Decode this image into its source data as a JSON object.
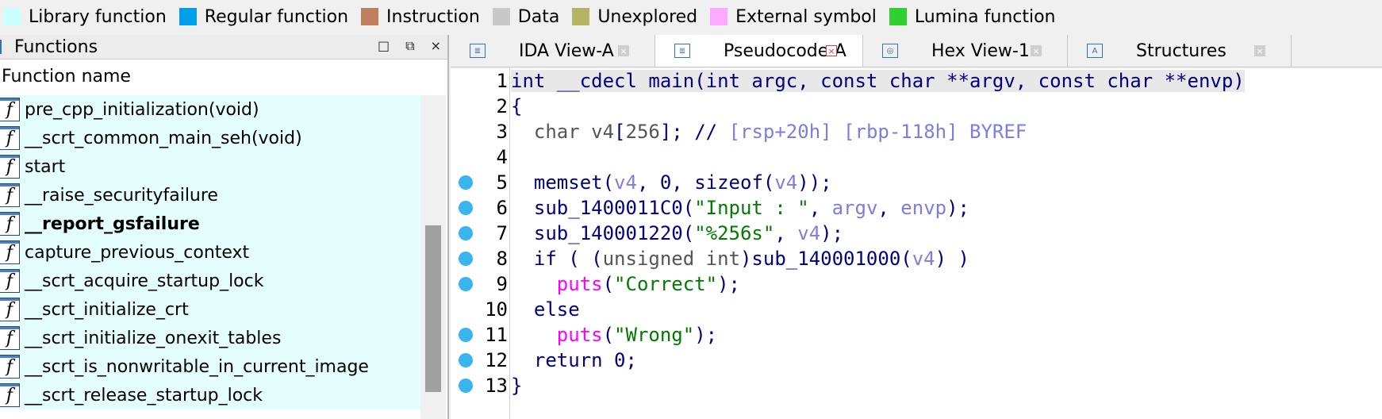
{
  "legend": [
    {
      "label": "Library function",
      "color": "#ccffff"
    },
    {
      "label": "Regular function",
      "color": "#00a0e8"
    },
    {
      "label": "Instruction",
      "color": "#c08060"
    },
    {
      "label": "Data",
      "color": "#c8c8c8"
    },
    {
      "label": "Unexplored",
      "color": "#b4b464"
    },
    {
      "label": "External symbol",
      "color": "#ffa8ff"
    },
    {
      "label": "Lumina function",
      "color": "#30d030"
    }
  ],
  "functions_panel": {
    "title": "Functions",
    "column_header": "Function name",
    "icon_glyph": "f",
    "buttons": [
      "□",
      "⧉",
      "×"
    ],
    "items": [
      {
        "name": "pre_cpp_initialization(void)",
        "bold": false
      },
      {
        "name": "__scrt_common_main_seh(void)",
        "bold": false
      },
      {
        "name": "start",
        "bold": false
      },
      {
        "name": "__raise_securityfailure",
        "bold": false
      },
      {
        "name": "__report_gsfailure",
        "bold": true
      },
      {
        "name": "capture_previous_context",
        "bold": false
      },
      {
        "name": "__scrt_acquire_startup_lock",
        "bold": false
      },
      {
        "name": "__scrt_initialize_crt",
        "bold": false
      },
      {
        "name": "__scrt_initialize_onexit_tables",
        "bold": false
      },
      {
        "name": "__scrt_is_nonwritable_in_current_image",
        "bold": false
      },
      {
        "name": "__scrt_release_startup_lock",
        "bold": false
      }
    ]
  },
  "tabs": [
    {
      "label": "IDA View-A",
      "active": false,
      "icon": "≣"
    },
    {
      "label": "Pseudocode-A",
      "active": true,
      "icon": "≣"
    },
    {
      "label": "Hex View-1",
      "active": false,
      "icon": "◎"
    },
    {
      "label": "Structures",
      "active": false,
      "icon": "A"
    }
  ],
  "code": {
    "lines": [
      {
        "n": "1",
        "bp": false,
        "hl": true,
        "parts": [
          [
            "kw",
            "int __cdecl main(int argc, const char **argv, const char **envp)"
          ]
        ]
      },
      {
        "n": "2",
        "bp": false,
        "hl": false,
        "parts": [
          [
            "plain",
            "{"
          ]
        ]
      },
      {
        "n": "3",
        "bp": false,
        "hl": false,
        "parts": [
          [
            "ty",
            "  char v4"
          ],
          [
            "plain",
            "["
          ],
          [
            "ty",
            "256"
          ],
          [
            "plain",
            "]; // "
          ],
          [
            "cm",
            "[rsp+20h] [rbp-118h] BYREF"
          ]
        ]
      },
      {
        "n": "4",
        "bp": false,
        "hl": false,
        "parts": []
      },
      {
        "n": "5",
        "bp": true,
        "hl": false,
        "parts": [
          [
            "plain",
            "  memset("
          ],
          [
            "var",
            "v4"
          ],
          [
            "plain",
            ", 0, sizeof("
          ],
          [
            "var",
            "v4"
          ],
          [
            "plain",
            "));"
          ]
        ]
      },
      {
        "n": "6",
        "bp": true,
        "hl": false,
        "parts": [
          [
            "plain",
            "  sub_1400011C0("
          ],
          [
            "str",
            "\"Input : \""
          ],
          [
            "plain",
            ", "
          ],
          [
            "var",
            "argv"
          ],
          [
            "plain",
            ", "
          ],
          [
            "var",
            "envp"
          ],
          [
            "plain",
            ");"
          ]
        ]
      },
      {
        "n": "7",
        "bp": true,
        "hl": false,
        "parts": [
          [
            "plain",
            "  sub_140001220("
          ],
          [
            "str",
            "\"%256s\""
          ],
          [
            "plain",
            ", "
          ],
          [
            "var",
            "v4"
          ],
          [
            "plain",
            ");"
          ]
        ]
      },
      {
        "n": "8",
        "bp": true,
        "hl": false,
        "parts": [
          [
            "plain",
            "  if ( ("
          ],
          [
            "ty",
            "unsigned int"
          ],
          [
            "plain",
            ")sub_140001000("
          ],
          [
            "var",
            "v4"
          ],
          [
            "plain",
            ") )"
          ]
        ]
      },
      {
        "n": "9",
        "bp": true,
        "hl": false,
        "parts": [
          [
            "imp",
            "    puts"
          ],
          [
            "plain",
            "("
          ],
          [
            "str",
            "\"Correct\""
          ],
          [
            "plain",
            ");"
          ]
        ]
      },
      {
        "n": "10",
        "bp": false,
        "hl": false,
        "parts": [
          [
            "plain",
            "  else"
          ]
        ]
      },
      {
        "n": "11",
        "bp": true,
        "hl": false,
        "parts": [
          [
            "imp",
            "    puts"
          ],
          [
            "plain",
            "("
          ],
          [
            "str",
            "\"Wrong\""
          ],
          [
            "plain",
            ");"
          ]
        ]
      },
      {
        "n": "12",
        "bp": true,
        "hl": false,
        "parts": [
          [
            "plain",
            "  return 0;"
          ]
        ]
      },
      {
        "n": "13",
        "bp": true,
        "hl": false,
        "parts": [
          [
            "plain",
            "}"
          ]
        ]
      }
    ]
  }
}
